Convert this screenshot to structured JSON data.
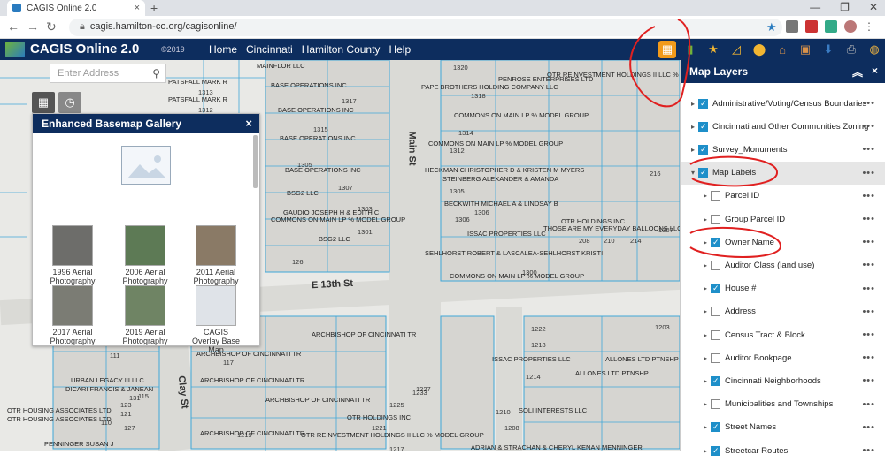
{
  "browser": {
    "tab_title": "CAGIS Online 2.0",
    "url": "cagis.hamilton-co.org/cagisonline/"
  },
  "header": {
    "title": "CAGIS Online 2.0",
    "copyright": "©2019",
    "nav": [
      "Home",
      "Cincinnati",
      "Hamilton County",
      "Help"
    ]
  },
  "search": {
    "placeholder": "Enter Address"
  },
  "gallery": {
    "title": "Enhanced Basemap Gallery",
    "items": [
      {
        "label": "1996 Aerial Photography"
      },
      {
        "label": "2006 Aerial Photography"
      },
      {
        "label": "2011 Aerial Photography"
      },
      {
        "label": "2017 Aerial Photography"
      },
      {
        "label": "2019 Aerial Photography"
      },
      {
        "label": "CAGIS Overlay Base Map"
      }
    ]
  },
  "layers_panel": {
    "title": "Map Layers",
    "layers": [
      {
        "label": "Administrative/Voting/Census Boundaries",
        "checked": true
      },
      {
        "label": "Cincinnati and Other Communities Zoning",
        "checked": true
      },
      {
        "label": "Survey_Monuments",
        "checked": true
      },
      {
        "label": "Map Labels",
        "checked": true
      },
      {
        "label": "Parcel ID",
        "checked": false
      },
      {
        "label": "Group Parcel ID",
        "checked": false
      },
      {
        "label": "Owner Name",
        "checked": true
      },
      {
        "label": "Auditor Class (land use)",
        "checked": false
      },
      {
        "label": "House #",
        "checked": true
      },
      {
        "label": "Address",
        "checked": false
      },
      {
        "label": "Census Tract & Block",
        "checked": false
      },
      {
        "label": "Auditor Bookpage",
        "checked": false
      },
      {
        "label": "Cincinnati Neighborhoods",
        "checked": true
      },
      {
        "label": "Municipalities and Townships",
        "checked": false
      },
      {
        "label": "Street Names",
        "checked": true
      },
      {
        "label": "Streetcar Routes",
        "checked": true
      }
    ]
  },
  "map": {
    "streets": [
      "Main St",
      "E 13th St",
      "Clay St"
    ],
    "owners": [
      "MAINFLOR LLC",
      "BASE OPERATIONS INC",
      "BASE OPERATIONS INC",
      "BASE OPERATIONS INC",
      "BASE OPERATIONS INC",
      "BSG2 LLC",
      "BSG2 LLC",
      "GAUDIO JOSEPH H & EDITH C",
      "COMMONS ON MAIN LP % MODEL GROUP",
      "PAPE BROTHERS HOLDING COMPANY LLC",
      "OTR REINVESTMENT HOLDINGS II LLC % MODEL",
      "PENROSE ENTERPRISES LTD",
      "COMMONS ON MAIN LP % MODEL GROUP",
      "COMMONS ON MAIN LP % MODEL GROUP",
      "HECKMAN CHRISTOPHER D & KRISTEN M MYERS",
      "STEINBERG ALEXANDER & AMANDA",
      "BECKWITH MICHAEL A & LINDSAY B",
      "ISSAC PROPERTIES LLC",
      "SEHLHORST ROBERT & LASCALEA-SEHLHORST KRISTI",
      "COMMONS ON MAIN LP % MODEL GROUP",
      "OTR HOLDINGS INC",
      "THOSE ARE MY EVERYDAY BALLOONS LLC",
      "PATSFALL MARK R",
      "PATSFALL MARK R",
      "ARCHBISHOP OF CINCINNATI TR",
      "ARCHBISHOP OF CINCINNATI TR",
      "ARCHBISHOP OF CINCINNATI TR",
      "ARCHBISHOP OF CINCINNATI TR",
      "ARCHBISHOP OF CINCINNATI TR",
      "ISSAC PROPERTIES LLC",
      "ALLONES LTD PTNSHP",
      "ALLONES LTD PTNSHP",
      "SOLI INTERESTS LLC",
      "OTR HOUSING ASSOCIATES LTD",
      "OTR HOUSING ASSOCIATES LTD",
      "URBAN LEGACY III LLC",
      "DICARI FRANCIS & JANEAN",
      "OTR HOLDINGS INC",
      "OTR REINVESTMENT HOLDINGS II LLC % MODEL GROUP",
      "PENNINGER SUSAN J",
      "ADRIAN & STRACHAN & CHERYL KENAN MENNINGER"
    ],
    "numbers": [
      "1313",
      "1312",
      "1317",
      "1315",
      "1305",
      "1307",
      "1303",
      "1301",
      "1318",
      "1320",
      "1314",
      "1312",
      "1305",
      "1306",
      "1306",
      "1300",
      "1307",
      "1222",
      "1203",
      "1218",
      "1214",
      "1210",
      "1208",
      "1227",
      "1233",
      "1225",
      "1221",
      "1219",
      "1217",
      "126",
      "216",
      "208",
      "210",
      "214",
      "131",
      "127",
      "123",
      "121",
      "111",
      "117",
      "110",
      "115"
    ]
  }
}
